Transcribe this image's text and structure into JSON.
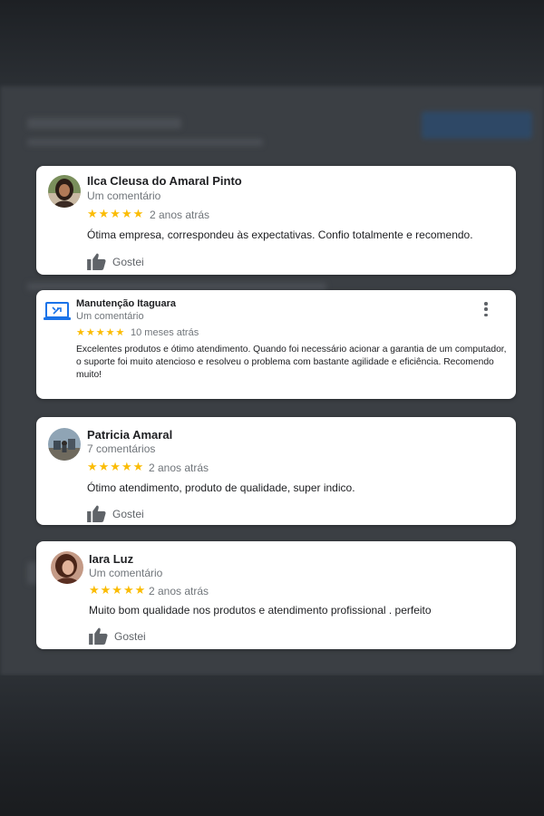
{
  "reviews": [
    {
      "name": "Ilca Cleusa do Amaral Pinto",
      "subtitle": "Um comentário",
      "stars": "★★★★★",
      "rating": 5,
      "time": "2 anos atrás",
      "text": "Ótima empresa, correspondeu às expectativas. Confio totalmente e recomendo.",
      "like_label": "Gostei"
    },
    {
      "name": "Manutenção Itaguara",
      "subtitle": "Um comentário",
      "stars": "★★★★★",
      "rating": 5,
      "time": "10 meses atrás",
      "text": "Excelentes produtos e ótimo atendimento. Quando foi necessário acionar a garantia de um computador, o suporte foi muito atencioso e resolveu o problema com bastante agilidade e eficiência. Recomendo muito!"
    },
    {
      "name": "Patricia Amaral",
      "subtitle": "7 comentários",
      "stars": "★★★★★",
      "rating": 5,
      "time": "2 anos atrás",
      "text": "Ótimo atendimento, produto de qualidade, super indico.",
      "like_label": "Gostei"
    },
    {
      "name": "Iara Luz",
      "subtitle": "Um comentário",
      "stars": "★★★★★",
      "rating": 5,
      "time": "2 anos atrás",
      "text": "Muito bom qualidade nos produtos e atendimento profissional . perfeito",
      "like_label": "Gostei"
    }
  ],
  "colors": {
    "star": "#fbbc04",
    "name": "#202124",
    "secondary": "#70757a",
    "icon": "#5f6368",
    "laptop_icon": "#1a73e8"
  }
}
